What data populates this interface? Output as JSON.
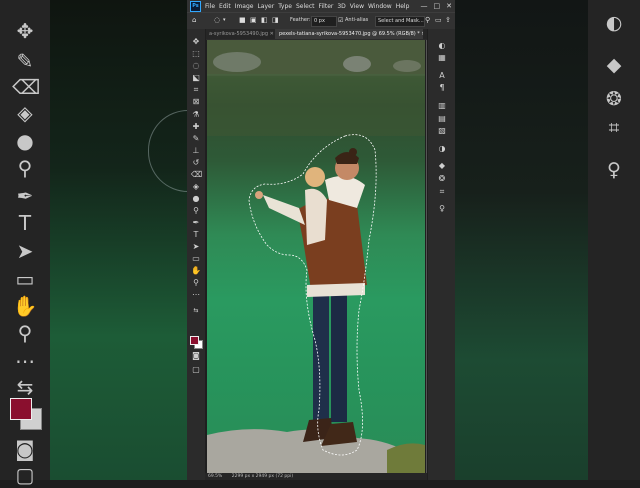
{
  "menubar": {
    "logo": "Ps",
    "items": [
      "File",
      "Edit",
      "Image",
      "Layer",
      "Type",
      "Select",
      "Filter",
      "3D",
      "View",
      "Window",
      "Help"
    ],
    "minimize": "—",
    "maximize": "□",
    "close": "✕"
  },
  "options_bar": {
    "feather_label": "Feather:",
    "feather_value": "0 px",
    "antialias_label": "Anti-alias",
    "select_mask_label": "Select and Mask..."
  },
  "tabs": [
    {
      "label": "a-syrikova-5953490.jpg",
      "close": "✕"
    },
    {
      "label": "pexels-tatiana-syrikova-5953470.jpg @ 69.5% (RGB/8) *",
      "close": "✕"
    }
  ],
  "status": {
    "zoom": "69.5%",
    "doc_size": "2299 px x 2949 px (72 ppi)"
  },
  "colors": {
    "foreground": "#8a0f2e",
    "background": "#ffffff",
    "ps_blue": "#31a8ff"
  },
  "tools": [
    "move-icon",
    "marquee-icon",
    "lasso-icon",
    "object-select-icon",
    "crop-icon",
    "frame-icon",
    "eyedropper-icon",
    "healing-icon",
    "brush-icon",
    "stamp-icon",
    "history-brush-icon",
    "eraser-icon",
    "gradient-icon",
    "blur-icon",
    "dodge-icon",
    "pen-icon",
    "type-icon",
    "path-select-icon",
    "rectangle-icon",
    "hand-icon",
    "zoom-icon",
    "more-icon"
  ],
  "right_panel_icons": [
    "color-icon",
    "swatches-icon",
    "character-icon",
    "paragraph-icon",
    "libraries-icon",
    "gradients-icon",
    "patterns-icon",
    "properties-icon",
    "layers-icon",
    "channels-icon",
    "paths-icon",
    "learn-icon"
  ]
}
